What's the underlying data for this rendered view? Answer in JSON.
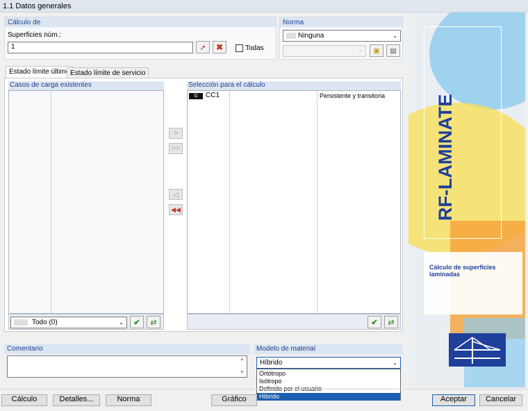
{
  "window": {
    "title": "1.1 Datos generales"
  },
  "calculo": {
    "header": "Cálculo de",
    "superficies_label": "Superficies núm.:",
    "superficies_value": "1",
    "todas_label": "Todas"
  },
  "norma": {
    "header": "Norma",
    "selected": "Ninguna"
  },
  "tabs": [
    {
      "label": "Estado límite último"
    },
    {
      "label": "Estado límite de servicio"
    }
  ],
  "casos": {
    "header": "Casos de carga existentes",
    "filter_value": "Todo (0)"
  },
  "seleccion": {
    "header": "Selección para el cálculo",
    "rows": [
      {
        "badge": "G",
        "id": "CC1",
        "type": "Persistente y transitoria"
      }
    ]
  },
  "transfer": {
    "add": ">",
    "add_all": ">>",
    "remove": "◁",
    "remove_all": "◀◀"
  },
  "comentario": {
    "header": "Comentario",
    "value": ""
  },
  "modelo": {
    "header": "Modelo de material",
    "selected": "Híbrido",
    "options": [
      "Ortótropo",
      "Isótropo",
      "Definido por el usuario",
      "Híbrido"
    ]
  },
  "banner": {
    "product": "RF-LAMINATE",
    "description": "Cálculo de superficies laminadas",
    "colors": {
      "blue": "#1e3f9a",
      "orange": "#f5a13a",
      "yellow": "#f7e05a",
      "sky": "#8ccbec"
    }
  },
  "footer": {
    "calculo": "Cálculo",
    "detalles": "Detalles...",
    "norma": "Norma",
    "grafico": "Gráfico",
    "aceptar": "Aceptar",
    "cancelar": "Cancelar"
  }
}
